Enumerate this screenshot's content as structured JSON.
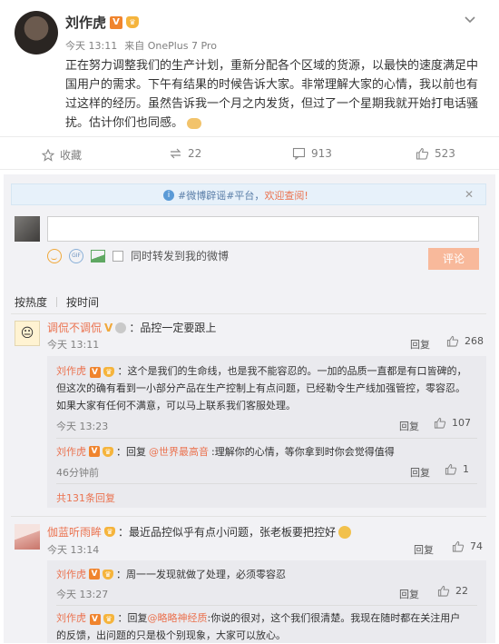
{
  "post": {
    "author": "刘作虎",
    "time": "今天 13:11",
    "source": "来自 OnePlus 7 Pro",
    "text_lines": [
      "正在努力调整我们的生产计划，重新分配各个区域的货源，以最快的速度满足中",
      "国用户的需求。下午有结果的时候告诉大家。非常理解大家的心情，我以前也有",
      "过这样的经历。虽然告诉我一个月之内发货，但过了一个星期我就开始打电话骚",
      "扰。估计你们也同感。"
    ]
  },
  "actions": {
    "favorite": "收藏",
    "repost": "22",
    "comment": "913",
    "like": "523"
  },
  "notice": {
    "text": "#微博辟谣#平台，欢迎查阅!",
    "prefix": "#微博辟谣#平台，",
    "highlight": "欢迎查阅!"
  },
  "composer": {
    "placeholder": "",
    "checkbox_label": "同时转发到我的微博",
    "submit": "评论"
  },
  "sort": {
    "hot": "按热度",
    "time": "按时间"
  },
  "comments": [
    {
      "user": "调侃不调侃",
      "text": "：品控一定要跟上",
      "time": "今天 13:11",
      "reply": "回复",
      "likes": "268",
      "subs": [
        {
          "user": "刘作虎",
          "lines": [
            "：这个是我们的生命线，也是我不能容忍的。一加的品质一直都是有口皆碑的，",
            "但这次的确有看到一小部分产品在生产控制上有点问题，已经勒令生产线加强管控，零容忍。",
            "如果大家有任何不满意，可以马上联系我们客服处理。"
          ],
          "time": "今天 13:23",
          "reply": "回复",
          "likes": "107"
        },
        {
          "user": "刘作虎",
          "reply_prefix": "：回复",
          "mention": "@世界最高音",
          "text": ":理解你的心情，等你拿到时你会觉得值得",
          "time": "46分钟前",
          "reply": "回复",
          "likes": "1"
        }
      ],
      "more": "共131条回复"
    },
    {
      "user": "伽蓝听雨眸",
      "text": "：最近品控似乎有点小问题，张老板要把控好",
      "time": "今天 13:14",
      "reply": "回复",
      "likes": "74",
      "subs": [
        {
          "user": "刘作虎",
          "lines": [
            "：周一一发现就做了处理，必须零容忍"
          ],
          "time": "今天 13:27",
          "reply": "回复",
          "likes": "22"
        },
        {
          "user": "刘作虎",
          "reply_prefix": "：回复",
          "mention": "@略略神经质",
          "text": ":你说的很对，这个我们很清楚。我现在随时都在关注用户",
          "line2": "的反馈，出问题的只是极个别现象，大家可以放心。"
        }
      ]
    }
  ]
}
